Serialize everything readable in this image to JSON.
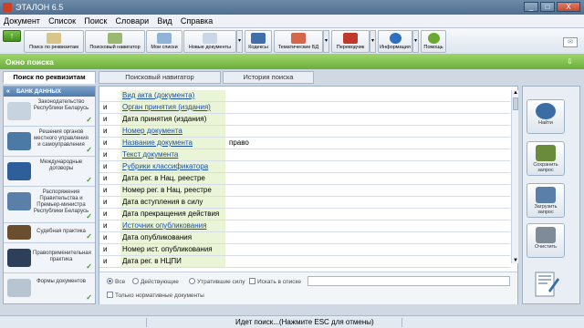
{
  "app": {
    "title": "ЭТАЛОН 6.5"
  },
  "window_controls": {
    "minimize": "_",
    "maximize": "□",
    "close": "X"
  },
  "menu": [
    "Документ",
    "Список",
    "Поиск",
    "Словари",
    "Вид",
    "Справка"
  ],
  "toolbar": {
    "home": "↑",
    "buttons": [
      {
        "label": "Поиск по реквизитам",
        "icon": "magnifier-icon",
        "color": "#d9c48a"
      },
      {
        "label": "Поисковый навигатор",
        "icon": "navigator-icon",
        "color": "#9ab870"
      },
      {
        "label": "Мои списки",
        "icon": "list-icon",
        "color": "#8fb4d8"
      },
      {
        "label": "Новые документы",
        "icon": "new-docs-icon",
        "color": "#c9d7e6"
      },
      {
        "label": "Кодексы",
        "icon": "codes-icon",
        "color": "#3f6fa8"
      },
      {
        "label": "Тематические БД",
        "icon": "thematic-db-icon",
        "color": "#d4664a"
      },
      {
        "label": "Переводчик",
        "icon": "translator-icon",
        "color": "#c03a2c"
      },
      {
        "label": "Информация",
        "icon": "info-icon",
        "color": "#2e6fc0"
      },
      {
        "label": "Помощь",
        "icon": "help-icon",
        "color": "#6aa832"
      }
    ],
    "dropdown_glyph": "▾"
  },
  "search_window": {
    "label": "Окно поиска",
    "pin_glyph": "⇩"
  },
  "tabs": [
    "Поиск по реквизитам",
    "Поисковый навигатор",
    "История поиска"
  ],
  "sidebar": {
    "header": "БАНК ДАННЫХ",
    "header_arrow": "«",
    "items": [
      {
        "label": "Законодательство Республики Беларусь",
        "icon": "belarus-map-icon",
        "color": "#c7d3df"
      },
      {
        "label": "Решения органов местного управления и самоуправления",
        "icon": "desk-icon",
        "color": "#4b7aa7"
      },
      {
        "label": "Международные договоры",
        "icon": "world-map-icon",
        "color": "#2f5f9a"
      },
      {
        "label": "Распоряжения Правительства и Премьер-министра Республики Беларусь",
        "icon": "government-icon",
        "color": "#5a7fa8"
      },
      {
        "label": "Судебная практика",
        "icon": "books-icon",
        "color": "#6b4e2e"
      },
      {
        "label": "Правоприменительная практика",
        "icon": "graduation-cap-icon",
        "color": "#2e3f5c"
      },
      {
        "label": "Формы документов",
        "icon": "pen-icon",
        "color": "#b7c4d1"
      }
    ],
    "check_glyph": "✓"
  },
  "search_rows": [
    {
      "op": "",
      "field": "Вид акта (документа)",
      "link": true,
      "value": ""
    },
    {
      "op": "и",
      "field": "Орган принятия (издания)",
      "link": true,
      "value": ""
    },
    {
      "op": "и",
      "field": "Дата принятия (издания)",
      "link": false,
      "value": ""
    },
    {
      "op": "и",
      "field": "Номер документа",
      "link": true,
      "value": ""
    },
    {
      "op": "и",
      "field": "Название документа",
      "link": true,
      "value": "право"
    },
    {
      "op": "и",
      "field": "Текст документа",
      "link": true,
      "value": ""
    },
    {
      "op": "и",
      "field": "Рубрики классификатора",
      "link": true,
      "value": ""
    },
    {
      "op": "и",
      "field": "Дата рег. в Нац. реестре",
      "link": false,
      "value": ""
    },
    {
      "op": "и",
      "field": "Номер рег. в Нац. реестре",
      "link": false,
      "value": ""
    },
    {
      "op": "и",
      "field": "Дата вступления в силу",
      "link": false,
      "value": ""
    },
    {
      "op": "и",
      "field": "Дата прекращения действия",
      "link": false,
      "value": ""
    },
    {
      "op": "и",
      "field": "Источник опубликования",
      "link": true,
      "value": ""
    },
    {
      "op": "и",
      "field": "Дата опубликования",
      "link": false,
      "value": ""
    },
    {
      "op": "и",
      "field": "Номер ист. опубликования",
      "link": false,
      "value": ""
    },
    {
      "op": "и",
      "field": "Дата рег. в НЦПИ",
      "link": false,
      "value": ""
    }
  ],
  "filters": {
    "all": "Все",
    "active": "Действующие",
    "expired": "Утратившие силу",
    "search_in_list": "Искать в списке",
    "normative_only": "Только нормативные документы",
    "selected": "all"
  },
  "actions": [
    {
      "label": "Найти",
      "icon": "find-icon",
      "color": "#3a6da3"
    },
    {
      "label": "Сохранить запрос",
      "icon": "save-query-icon",
      "color": "#6a8a3c"
    },
    {
      "label": "Загрузить запрос",
      "icon": "load-query-icon",
      "color": "#5a7fa8"
    },
    {
      "label": "Очистить",
      "icon": "clear-trash-icon",
      "color": "#7f8b97"
    }
  ],
  "status": {
    "message": "Идет поиск...(Нажмите ESC для отмены)"
  },
  "scroll": {
    "up": "▲",
    "down": "▼"
  }
}
